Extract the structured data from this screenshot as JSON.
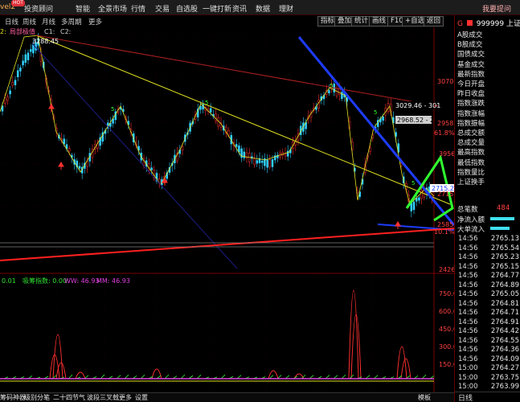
{
  "topbar": {
    "logo_fragment": "vel2",
    "hot_badge": "HOT",
    "menu": [
      "投资顾问",
      "智能",
      "全景市场",
      "行情",
      "交易",
      "自选股",
      "一键打新",
      "资讯",
      "数据",
      "理财"
    ],
    "help": "我要提问"
  },
  "toolbar": {
    "tabs": [
      "日线",
      "周线",
      "月线",
      "多周期",
      "更多"
    ],
    "buttons": [
      "指标",
      "叠加",
      "统计",
      "画线",
      "F10",
      "+自选",
      "返回"
    ]
  },
  "chart": {
    "indicator_legend": [
      "2:",
      "局部极值",
      "C1:",
      "C2:"
    ],
    "high_label": "3288.45",
    "price_labels": [
      {
        "text": "3029.46 - 301",
        "color": "#ffffff"
      },
      {
        "text": "2968.52 - 29",
        "color": "#ffffff"
      },
      {
        "text": "2715.2",
        "color": "#ffffff"
      }
    ],
    "axis_labels": [
      {
        "text": "3070",
        "color": "#ff4040"
      },
      {
        "text": "2958",
        "color": "#ff4040"
      },
      {
        "text": "61.8%",
        "color": "#ff4040"
      },
      {
        "text": "3956",
        "color": "#ff4040"
      },
      {
        "text": "2715",
        "color": "#ff4040"
      },
      {
        "text": "2585",
        "color": "#ff4040"
      },
      {
        "text": "10.1%",
        "color": "#ff4040"
      },
      {
        "text": "2426",
        "color": "#ff4040"
      }
    ],
    "sub_legend": [
      {
        "text": "0.01",
        "color": "#30e030"
      },
      {
        "text": "吸筹指数: 0.00",
        "color": "#30e030"
      },
      {
        "text": "WW: 46.93",
        "color": "#e040e0"
      },
      {
        "text": "MM: 46.93",
        "color": "#e040e0"
      }
    ],
    "sub_axis": [
      "750.0",
      "600.0",
      "450.0",
      "300.0",
      "150.0"
    ],
    "volume_sample": "484",
    "colors": {
      "up": "#ff3030",
      "down": "#30d0ff",
      "trend_blue": "#1e3cff",
      "zigzag": "#30ff30",
      "yellow": "#e0e020",
      "red_line": "#ff2020"
    }
  },
  "bottombar": {
    "tabs": [
      "筹码神器",
      "级别分笔",
      "二十四节气",
      "波段三叉戟",
      "更多",
      "设置"
    ],
    "right": [
      "模板"
    ]
  },
  "rightpanel": {
    "code": "999999",
    "name": "上证指",
    "list": [
      "A股成交",
      "B股成交",
      "国债成交",
      "基金成交",
      "最新指数",
      "今日开盘",
      "昨日收盘",
      "指数涨跌",
      "指数涨幅",
      "指数振幅",
      "总成交额",
      "总成交量",
      "最高指数",
      "最低指数",
      "指数量比",
      "上证换手"
    ],
    "vol_label": "总笔数",
    "vol_value": "484",
    "flow": [
      "净流入额",
      "大单流入"
    ],
    "ticks": [
      {
        "time": "14:56",
        "price": "2765.13"
      },
      {
        "time": "14:56",
        "price": "2765.54"
      },
      {
        "time": "14:56",
        "price": "2765.23"
      },
      {
        "time": "14:56",
        "price": "2765.15"
      },
      {
        "time": "14:56",
        "price": "2764.77"
      },
      {
        "time": "14:56",
        "price": "2764.89"
      },
      {
        "time": "14:56",
        "price": "2765.05"
      },
      {
        "time": "14:56",
        "price": "2764.81"
      },
      {
        "time": "14:56",
        "price": "2764.71"
      },
      {
        "time": "14:56",
        "price": "2764.91"
      },
      {
        "time": "14:56",
        "price": "2764.42"
      },
      {
        "time": "14:56",
        "price": "2764.55"
      },
      {
        "time": "14:56",
        "price": "2764.36"
      },
      {
        "time": "14:56",
        "price": "2764.09"
      },
      {
        "time": "15:00",
        "price": "2764.27"
      },
      {
        "time": "15:00",
        "price": "2763.75"
      },
      {
        "time": "15:00",
        "price": "2763.99"
      }
    ],
    "bottom_tab": "日线"
  }
}
